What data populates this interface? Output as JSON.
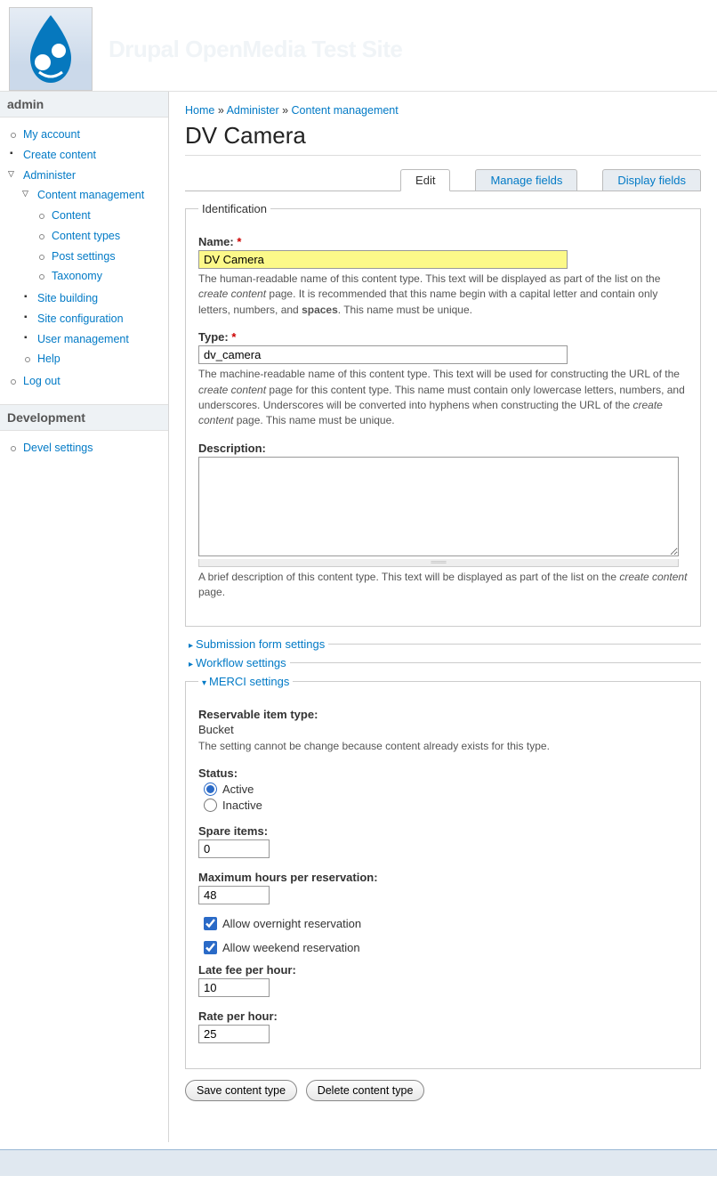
{
  "site_name": "Drupal OpenMedia Test Site",
  "sidebar": {
    "blocks": [
      {
        "title": "admin",
        "menu": "admin_menu"
      },
      {
        "title": "Development",
        "menu": "dev_menu"
      }
    ]
  },
  "admin_menu": {
    "my_account": "My account",
    "create_content": "Create content",
    "administer": "Administer",
    "content_management": "Content management",
    "content": "Content",
    "content_types": "Content types",
    "post_settings": "Post settings",
    "taxonomy": "Taxonomy",
    "site_building": "Site building",
    "site_configuration": "Site configuration",
    "user_management": "User management",
    "help": "Help",
    "log_out": "Log out"
  },
  "dev_menu": {
    "devel_settings": "Devel settings"
  },
  "breadcrumb": {
    "home": "Home",
    "administer": "Administer",
    "content_management": "Content management",
    "sep": " » "
  },
  "page_title": "DV Camera",
  "tabs": {
    "edit": "Edit",
    "manage_fields": "Manage fields",
    "display_fields": "Display fields"
  },
  "identification": {
    "legend": "Identification",
    "name_label": "Name:",
    "name_value": "DV Camera",
    "name_help_1": "The human-readable name of this content type. This text will be displayed as part of the list on the ",
    "name_help_em": "create content",
    "name_help_2": " page. It is recommended that this name begin with a capital letter and contain only letters, numbers, and ",
    "name_help_bold": "spaces",
    "name_help_3": ". This name must be unique.",
    "type_label": "Type:",
    "type_value": "dv_camera",
    "type_help_1": "The machine-readable name of this content type. This text will be used for constructing the URL of the ",
    "type_help_em1": "create content",
    "type_help_2": " page for this content type. This name must contain only lowercase letters, numbers, and underscores. Underscores will be converted into hyphens when constructing the URL of the ",
    "type_help_em2": "create content",
    "type_help_3": " page. This name must be unique.",
    "desc_label": "Description:",
    "desc_value": "",
    "desc_help_1": "A brief description of this content type. This text will be displayed as part of the list on the ",
    "desc_help_em": "create content",
    "desc_help_2": " page."
  },
  "collapsible": {
    "submission": "Submission form settings",
    "workflow": "Workflow settings",
    "merci": "MERCI settings"
  },
  "merci": {
    "reservable_label": "Reservable item type:",
    "reservable_value": "Bucket",
    "reservable_help": "The setting cannot be change because content already exists for this type.",
    "status_label": "Status:",
    "status_active": "Active",
    "status_inactive": "Inactive",
    "spare_label": "Spare items:",
    "spare_value": "0",
    "max_label": "Maximum hours per reservation:",
    "max_value": "48",
    "overnight": "Allow overnight reservation",
    "weekend": "Allow weekend reservation",
    "latefee_label": "Late fee per hour:",
    "latefee_value": "10",
    "rate_label": "Rate per hour:",
    "rate_value": "25"
  },
  "buttons": {
    "save": "Save content type",
    "delete": "Delete content type"
  }
}
